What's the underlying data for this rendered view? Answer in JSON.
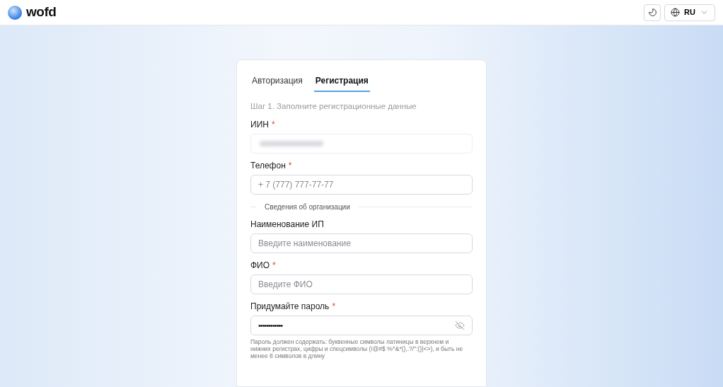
{
  "header": {
    "logo": "wofd",
    "language": "RU"
  },
  "tabs": [
    {
      "label": "Авторизация",
      "selected": false
    },
    {
      "label": "Регистрация",
      "selected": true
    }
  ],
  "step": "Шаг 1. Заполните регистрационные данные",
  "fields": [
    {
      "kind": "redacted",
      "label": "ИИН",
      "required_mark": "*"
    },
    {
      "kind": "text",
      "label": "Телефон",
      "required_mark": "*",
      "placeholder": "+ 7 (777) 777-77-77"
    },
    {
      "kind": "divider",
      "label": "Сведения об организации"
    },
    {
      "kind": "text",
      "label": "Наименование ИП",
      "placeholder": "Введите наименование"
    },
    {
      "kind": "text",
      "label": "ФИО",
      "required_mark": "*",
      "placeholder": "Введите ФИО"
    },
    {
      "kind": "password",
      "label": "Придумайте пароль",
      "required_mark": "*",
      "value": "••••••••••••",
      "hint": "Пароль должен содержать: буквенные символы латиницы в верхнем и нижних регистрах, цифры и спецсимволы (!@#$ %^&*(),.?/\":{}|<>), и быть не менее 8 символов в длину"
    }
  ]
}
